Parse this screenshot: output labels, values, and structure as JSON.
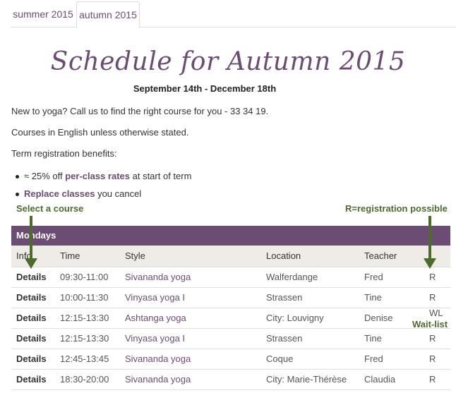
{
  "tabs": [
    {
      "label": "summer 2015"
    },
    {
      "label": "autumn 2015"
    }
  ],
  "page": {
    "title": "Schedule for Autumn 2015",
    "dates": "September 14th - December 18th",
    "intro1": "New to yoga? Call us to find the right course for you - 33 34 19.",
    "intro2": "Courses in English unless otherwise stated.",
    "intro3": "Term registration benefits:",
    "bullet1_pre": "≈ 25% off ",
    "bullet1_link": "per-class rates",
    "bullet1_post": " at start of term",
    "bullet2_link": "Replace classes",
    "bullet2_post": " you cancel"
  },
  "annotations": {
    "select": "Select a course",
    "registration": "R=registration possible",
    "waitlist": "Wait-list"
  },
  "table": {
    "day": "Mondays",
    "headers": {
      "info": "Info",
      "time": "Time",
      "style": "Style",
      "location": "Location",
      "teacher": "Teacher",
      "reg": ""
    },
    "rows": [
      {
        "info": "Details",
        "time": "09:30-11:00",
        "style": "Sivananda yoga",
        "location": "Walferdange",
        "teacher": "Fred",
        "reg": "R"
      },
      {
        "info": "Details",
        "time": "10:00-11:30",
        "style": "Vinyasa yoga I",
        "location": "Strassen",
        "teacher": "Tine",
        "reg": "R"
      },
      {
        "info": "Details",
        "time": "12:15-13:30",
        "style": "Ashtanga yoga",
        "location": "City: Louvigny",
        "teacher": "Denise",
        "reg": "WL"
      },
      {
        "info": "Details",
        "time": "12:15-13:30",
        "style": "Vinyasa yoga I",
        "location": "Strassen",
        "teacher": "Tine",
        "reg": "R"
      },
      {
        "info": "Details",
        "time": "12:45-13:45",
        "style": "Sivananda yoga",
        "location": "Coque",
        "teacher": "Fred",
        "reg": "R"
      },
      {
        "info": "Details",
        "time": "18:30-20:00",
        "style": "Sivananda yoga",
        "location": "City: Marie-Thérèse",
        "teacher": "Claudia",
        "reg": "R"
      }
    ]
  },
  "colors": {
    "brand": "#6b4c73",
    "annotation": "#4d6b2a"
  }
}
